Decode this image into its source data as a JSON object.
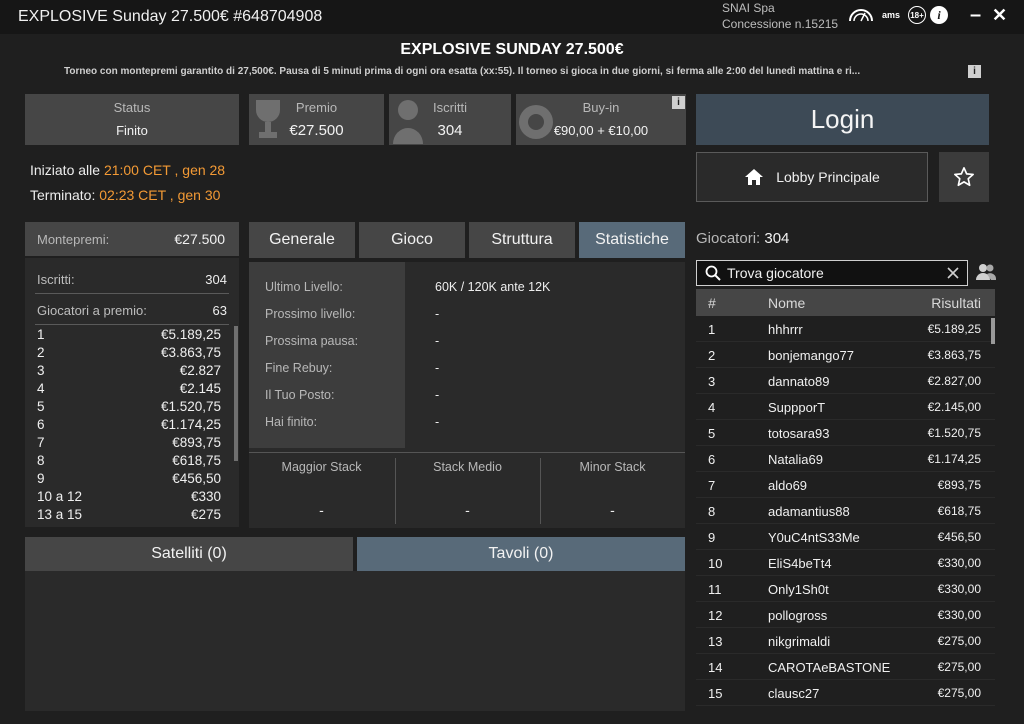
{
  "window": {
    "title": "EXPLOSIVE Sunday 27.500€ #648704908",
    "company_line1": "SNAI Spa",
    "company_line2": "Concessione n.15215",
    "logos": [
      "adm-logo-icon",
      "ams-logo-icon",
      "18-plus-icon",
      "info-icon"
    ],
    "logo_text_ams": "ams",
    "logo_text_18": "18+",
    "logo_text_info": "i",
    "minimize_label": "–",
    "close_label": "✕"
  },
  "header": {
    "title": "EXPLOSIVE SUNDAY 27.500€",
    "description": "Torneo con montepremi garantito di 27,500€. Pausa di 5 minuti prima di ogni ora esatta (xx:55). Il torneo si gioca in due giorni, si ferma alle 2:00 del lunedì mattina e ri...",
    "info_label": "i"
  },
  "summary": {
    "status_label": "Status",
    "status_value": "Finito",
    "premio_label": "Premio",
    "premio_value": "€27.500",
    "iscritti_label": "Iscritti",
    "iscritti_value": "304",
    "buyin_label": "Buy-in",
    "buyin_value": "€90,00 + €10,00",
    "info_label": "i"
  },
  "timeline": {
    "started_label": "Iniziato alle",
    "started_value": "21:00 CET , gen 28",
    "ended_label": "Terminato:",
    "ended_value": "02:23 CET , gen 30"
  },
  "actions": {
    "login_label": "Login",
    "lobby_label": "Lobby Principale",
    "home_icon": "home-icon",
    "star_icon": "star-icon"
  },
  "prizes": {
    "montepremi_label": "Montepremi:",
    "montepremi_value": "€27.500",
    "iscritti_label": "Iscritti:",
    "iscritti_value": "304",
    "winners_label": "Giocatori a premio:",
    "winners_value": "63",
    "list": [
      {
        "pos": "1",
        "amount": "€5.189,25"
      },
      {
        "pos": "2",
        "amount": "€3.863,75"
      },
      {
        "pos": "3",
        "amount": "€2.827"
      },
      {
        "pos": "4",
        "amount": "€2.145"
      },
      {
        "pos": "5",
        "amount": "€1.520,75"
      },
      {
        "pos": "6",
        "amount": "€1.174,25"
      },
      {
        "pos": "7",
        "amount": "€893,75"
      },
      {
        "pos": "8",
        "amount": "€618,75"
      },
      {
        "pos": "9",
        "amount": "€456,50"
      },
      {
        "pos": "10 a 12",
        "amount": "€330"
      },
      {
        "pos": "13 a 15",
        "amount": "€275"
      }
    ]
  },
  "tabs": [
    "Generale",
    "Gioco",
    "Struttura",
    "Statistiche"
  ],
  "stats": {
    "rows": [
      {
        "label": "Ultimo Livello:",
        "value": "60K / 120K ante 12K"
      },
      {
        "label": "Prossimo livello:",
        "value": "-"
      },
      {
        "label": "Prossima pausa:",
        "value": "-"
      },
      {
        "label": "Fine Rebuy:",
        "value": "-"
      },
      {
        "label": "Il Tuo Posto:",
        "value": "-"
      },
      {
        "label": "Hai finito:",
        "value": "-"
      }
    ],
    "stack": [
      {
        "label": "Maggior Stack",
        "value": "-"
      },
      {
        "label": "Stack Medio",
        "value": "-"
      },
      {
        "label": "Minor Stack",
        "value": "-"
      }
    ]
  },
  "bottom_tabs": {
    "satelliti": "Satelliti (0)",
    "tavoli": "Tavoli (0)"
  },
  "players": {
    "count_label": "Giocatori:",
    "count_value": "304",
    "search_placeholder": "Trova giocatore",
    "col_rank": "#",
    "col_name": "Nome",
    "col_result": "Risultati",
    "rows": [
      {
        "rank": "1",
        "name": "hhhrrr",
        "result": "€5.189,25"
      },
      {
        "rank": "2",
        "name": "bonjemango77",
        "result": "€3.863,75"
      },
      {
        "rank": "3",
        "name": "dannato89",
        "result": "€2.827,00"
      },
      {
        "rank": "4",
        "name": "SuppporT",
        "result": "€2.145,00"
      },
      {
        "rank": "5",
        "name": "totosara93",
        "result": "€1.520,75"
      },
      {
        "rank": "6",
        "name": "Natalia69",
        "result": "€1.174,25"
      },
      {
        "rank": "7",
        "name": "aldo69",
        "result": "€893,75"
      },
      {
        "rank": "8",
        "name": "adamantius88",
        "result": "€618,75"
      },
      {
        "rank": "9",
        "name": "Y0uC4ntS33Me",
        "result": "€456,50"
      },
      {
        "rank": "10",
        "name": "EliS4beTt4",
        "result": "€330,00"
      },
      {
        "rank": "11",
        "name": "Only1Sh0t",
        "result": "€330,00"
      },
      {
        "rank": "12",
        "name": "pollogross",
        "result": "€330,00"
      },
      {
        "rank": "13",
        "name": "nikgrimaldi",
        "result": "€275,00"
      },
      {
        "rank": "14",
        "name": "CAROTAeBASTONE",
        "result": "€275,00"
      },
      {
        "rank": "15",
        "name": "clausc27",
        "result": "€275,00"
      }
    ]
  },
  "colors": {
    "accent_orange": "#f39a35",
    "active_tab": "#586a79",
    "login_bg": "#3d4a56"
  }
}
